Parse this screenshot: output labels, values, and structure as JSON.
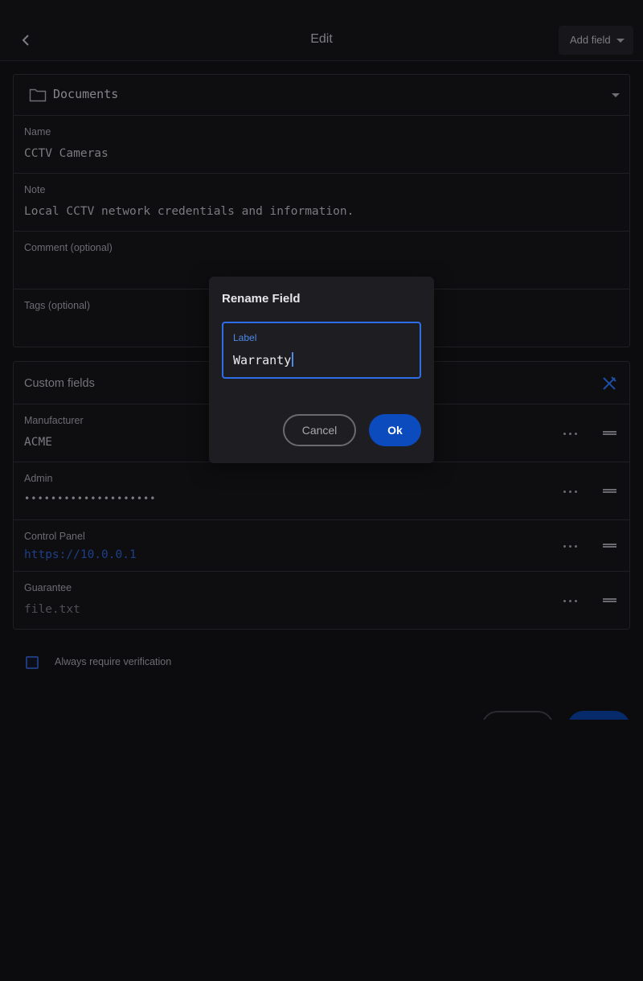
{
  "header": {
    "title": "Edit",
    "add_field_label": "Add field"
  },
  "folder": {
    "name": "Documents"
  },
  "fields": {
    "name": {
      "label": "Name",
      "value": "CCTV Cameras"
    },
    "note": {
      "label": "Note",
      "value": "Local CCTV network credentials and information."
    },
    "comment": {
      "label": "Comment (optional)",
      "value": ""
    },
    "tags": {
      "label": "Tags (optional)",
      "value": ""
    }
  },
  "custom_fields": {
    "title": "Custom fields",
    "items": [
      {
        "label": "Manufacturer",
        "value": "ACME"
      },
      {
        "label": "Admin",
        "value": "••••••••••••••••••••"
      },
      {
        "label": "Control Panel",
        "value": "https://10.0.0.1"
      },
      {
        "label": "Guarantee",
        "value": "file.txt"
      }
    ]
  },
  "verification": {
    "label": "Always require verification",
    "checked": false
  },
  "dialog": {
    "title": "Rename Field",
    "field_label": "Label",
    "field_value": "Warranty",
    "cancel_label": "Cancel",
    "ok_label": "Ok"
  },
  "colors": {
    "background": "#0c0c0e",
    "dialog_bg": "#1d1d22",
    "accent": "#2e6ee8",
    "ok_button": "#0b4bbd",
    "link": "#1e3f8a"
  },
  "icons": [
    "chevron-left-icon",
    "caret-down-icon",
    "folder-icon",
    "tools-icon",
    "more-horizontal-icon",
    "drag-handle-icon"
  ]
}
